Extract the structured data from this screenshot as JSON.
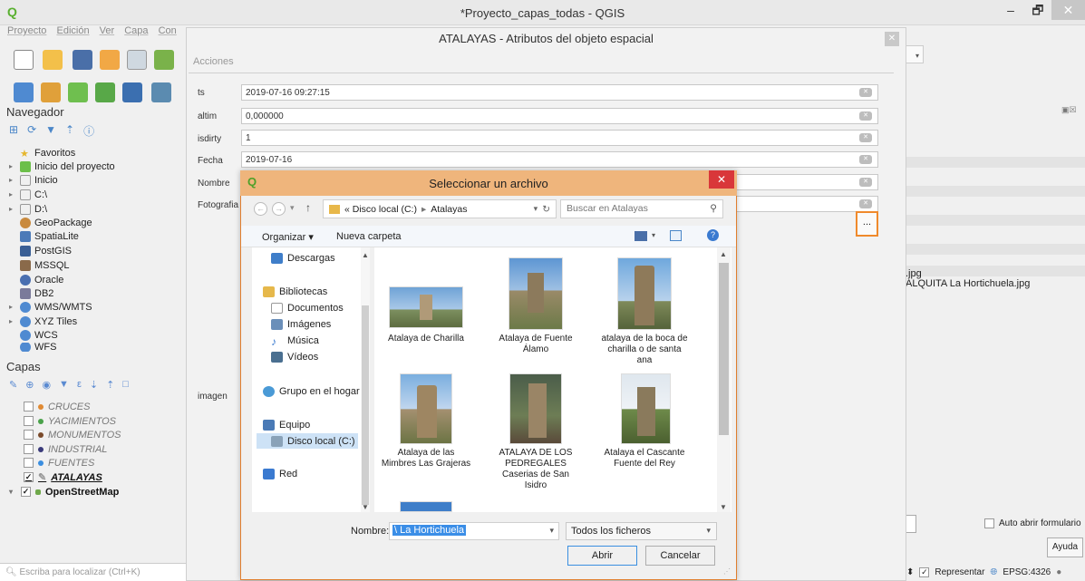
{
  "window": {
    "title": "*Proyecto_capas_todas - QGIS"
  },
  "menu": [
    "Proyecto",
    "Edición",
    "Ver",
    "Capa",
    "Con"
  ],
  "navigator": {
    "title": "Navegador",
    "items": [
      {
        "label": "Favoritos"
      },
      {
        "label": "Inicio del proyecto"
      },
      {
        "label": "Inicio"
      },
      {
        "label": "C:\\"
      },
      {
        "label": "D:\\"
      },
      {
        "label": "GeoPackage"
      },
      {
        "label": "SpatiaLite"
      },
      {
        "label": "PostGIS"
      },
      {
        "label": "MSSQL"
      },
      {
        "label": "Oracle"
      },
      {
        "label": "DB2"
      },
      {
        "label": "WMS/WMTS"
      },
      {
        "label": "XYZ Tiles"
      },
      {
        "label": "WCS"
      },
      {
        "label": "WFS"
      }
    ]
  },
  "layers": {
    "title": "Capas",
    "items": [
      {
        "label": "CRUCES",
        "color": "#e08a33"
      },
      {
        "label": "YACIMIENTOS",
        "color": "#4aa24a"
      },
      {
        "label": "MONUMENTOS",
        "color": "#7a4a2a"
      },
      {
        "label": "INDUSTRIAL",
        "color": "#3a3a7a"
      },
      {
        "label": "FUENTES",
        "color": "#3a8ee0"
      },
      {
        "label": "ATALAYAS",
        "checked": "✓"
      },
      {
        "label": "OpenStreetMap",
        "checked": "✓"
      }
    ]
  },
  "locator": {
    "placeholder": "Escriba para localizar (Ctrl+K)"
  },
  "attr_form": {
    "title": "ATALAYAS - Atributos del objeto espacial",
    "actions_tab": "Acciones",
    "fields": [
      {
        "label": "ts",
        "value": "2019-07-16 09:27:15"
      },
      {
        "label": "altim",
        "value": "0,000000"
      },
      {
        "label": "isdirty",
        "value": "1"
      },
      {
        "label": "Fecha",
        "value": "2019-07-16"
      },
      {
        "label": "Nombre",
        "value": ""
      },
      {
        "label": "Fotografia",
        "value": ""
      }
    ],
    "image_label": "imagen",
    "browse_label": "..."
  },
  "right_panel": {
    "file1": ".jpg",
    "file2": "ALQUITA La Hortichuela.jpg",
    "auto_open": "Auto abrir formulario",
    "help": "Ayuda",
    "render": "Representar",
    "crs": "EPSG:4326"
  },
  "file_dialog": {
    "title": "Seleccionar un archivo",
    "path": [
      "« Disco local (C:)",
      "Atalayas"
    ],
    "search_placeholder": "Buscar en Atalayas",
    "organize": "Organizar ▾",
    "new_folder": "Nueva carpeta",
    "left_items": [
      {
        "label": "Descargas"
      },
      {
        "label": "Bibliotecas"
      },
      {
        "label": "Documentos"
      },
      {
        "label": "Imágenes"
      },
      {
        "label": "Música"
      },
      {
        "label": "Vídeos"
      },
      {
        "label": "Grupo en el hogar"
      },
      {
        "label": "Equipo"
      },
      {
        "label": "Disco local (C:)"
      },
      {
        "label": "Red"
      }
    ],
    "files": [
      {
        "name": "Atalaya de Charilla"
      },
      {
        "name": "Atalaya de Fuente Álamo"
      },
      {
        "name": "atalaya de la boca de charilla o de santa ana"
      },
      {
        "name": "Atalaya de las Mimbres Las Grajeras"
      },
      {
        "name": "ATALAYA DE LOS PEDREGALES Caserias de San Isidro"
      },
      {
        "name": "Atalaya el Cascante Fuente del Rey"
      }
    ],
    "filename_label": "Nombre:",
    "filename_value": "\\ La Hortichuela",
    "filter": "Todos los ficheros",
    "open": "Abrir",
    "cancel": "Cancelar"
  }
}
